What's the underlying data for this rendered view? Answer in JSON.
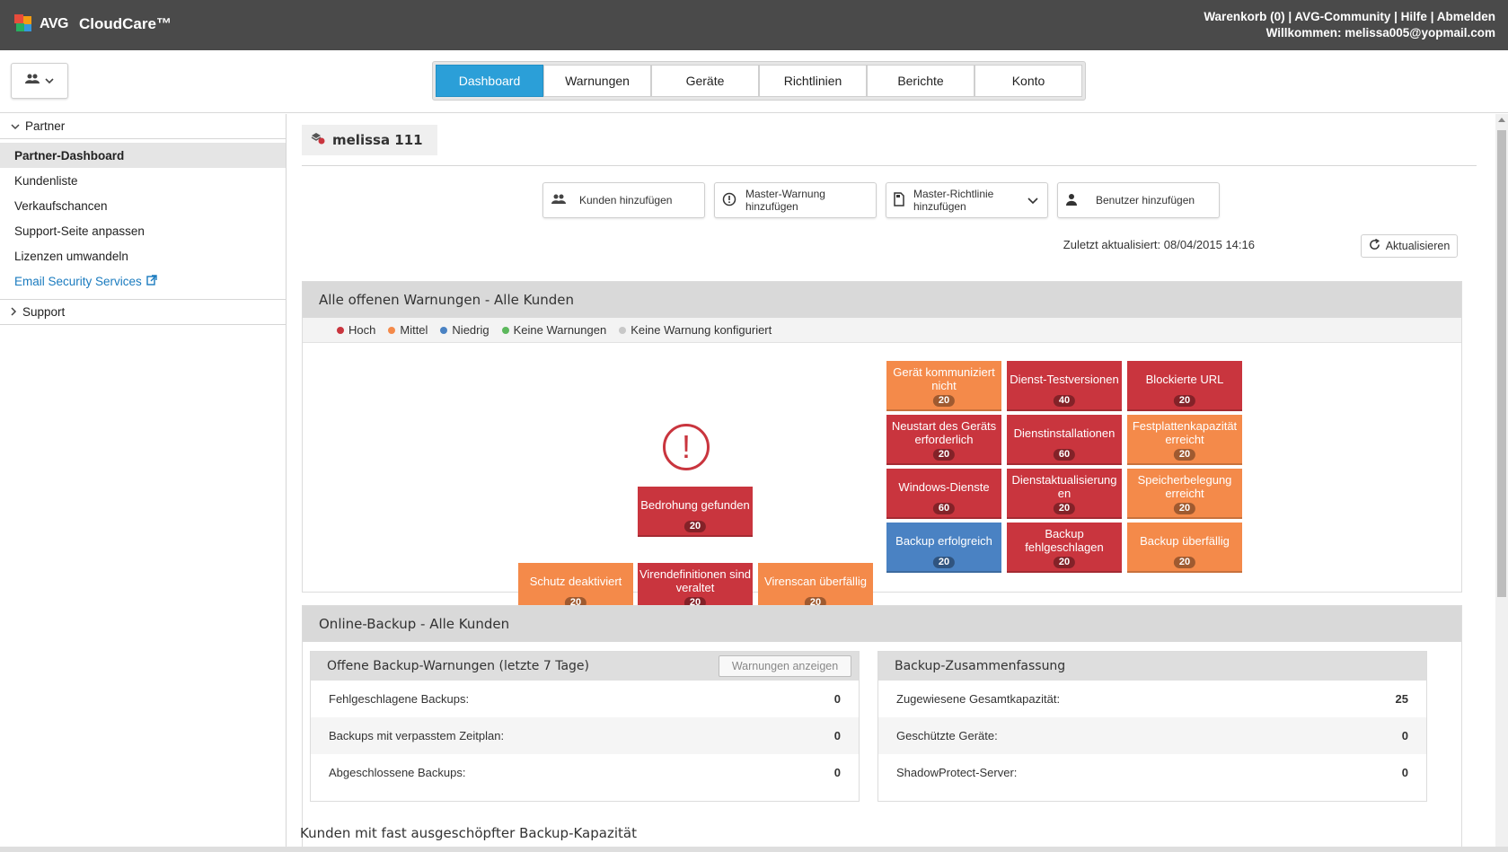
{
  "header": {
    "brand": "AVG",
    "product": "CloudCare™",
    "cart": "Warenkorb (0)",
    "community": "AVG-Community",
    "help": "Hilfe",
    "logout": "Abmelden",
    "welcome": "Willkommen: melissa005@yopmail.com"
  },
  "nav": {
    "tabs": [
      "Dashboard",
      "Warnungen",
      "Geräte",
      "Richtlinien",
      "Berichte",
      "Konto"
    ],
    "active_tab": "Dashboard"
  },
  "sidebar": {
    "partner_label": "Partner",
    "items": [
      "Partner-Dashboard",
      "Kundenliste",
      "Verkaufschancen",
      "Support-Seite anpassen",
      "Lizenzen umwandeln",
      "Email Security Services"
    ],
    "support_label": "Support"
  },
  "main": {
    "user_name": "melissa 111",
    "actions": [
      {
        "label": "Kunden hinzufügen",
        "icon": "users-icon"
      },
      {
        "label": "Master-Warnung hinzufügen",
        "icon": "alert-circle-icon"
      },
      {
        "label": "Master-Richtlinie hinzufügen",
        "icon": "document-icon"
      },
      {
        "label": "Benutzer hinzufügen",
        "icon": "user-icon"
      }
    ],
    "updated_label": "Zuletzt aktualisiert:",
    "updated_value": "08/04/2015 14:16",
    "refresh_label": "Aktualisieren"
  },
  "alerts": {
    "title": "Alle offenen Warnungen - Alle Kunden",
    "legend": [
      {
        "label": "Hoch",
        "color": "#c9353e"
      },
      {
        "label": "Mittel",
        "color": "#f48a4a"
      },
      {
        "label": "Niedrig",
        "color": "#4a82c3"
      },
      {
        "label": "Keine Warnungen",
        "color": "#5cb85c"
      },
      {
        "label": "Keine Warnung konfiguriert",
        "color": "#c8c8c8"
      }
    ],
    "tiles": {
      "threat": {
        "label": "Bedrohung gefunden",
        "count": "20",
        "severity": "high"
      },
      "protection_off": {
        "label": "Schutz deaktiviert",
        "count": "20",
        "severity": "medium"
      },
      "defs_outdated": {
        "label": "Virendefinitionen sind veraltet",
        "count": "20",
        "severity": "high"
      },
      "scan_overdue": {
        "label": "Virenscan überfällig",
        "count": "20",
        "severity": "medium"
      },
      "not_communicating": {
        "label": "Gerät kommuniziert nicht",
        "count": "20",
        "severity": "medium"
      },
      "service_trials": {
        "label": "Dienst-Testversionen",
        "count": "40",
        "severity": "high"
      },
      "blocked_url": {
        "label": "Blockierte URL",
        "count": "20",
        "severity": "high"
      },
      "restart_required": {
        "label": "Neustart des Geräts erforderlich",
        "count": "20",
        "severity": "high"
      },
      "service_installs": {
        "label": "Dienstinstallationen",
        "count": "60",
        "severity": "high"
      },
      "disk_capacity": {
        "label": "Festplattenkapazität erreicht",
        "count": "20",
        "severity": "medium"
      },
      "windows_services": {
        "label": "Windows-Dienste",
        "count": "60",
        "severity": "high"
      },
      "service_updates": {
        "label": "Dienstaktualisierung en",
        "count": "20",
        "severity": "high"
      },
      "memory_usage": {
        "label": "Speicherbelegung erreicht",
        "count": "20",
        "severity": "medium"
      },
      "backup_success": {
        "label": "Backup erfolgreich",
        "count": "20",
        "severity": "low"
      },
      "backup_failed": {
        "label": "Backup fehlgeschlagen",
        "count": "20",
        "severity": "high"
      },
      "backup_overdue": {
        "label": "Backup überfällig",
        "count": "20",
        "severity": "medium"
      }
    }
  },
  "backup": {
    "title": "Online-Backup - Alle Kunden",
    "warnings": {
      "title": "Offene Backup-Warnungen (letzte 7 Tage)",
      "button": "Warnungen anzeigen",
      "rows": [
        {
          "label": "Fehlgeschlagene Backups:",
          "value": "0"
        },
        {
          "label": "Backups mit verpasstem Zeitplan:",
          "value": "0"
        },
        {
          "label": "Abgeschlossene Backups:",
          "value": "0"
        }
      ]
    },
    "summary": {
      "title": "Backup-Zusammenfassung",
      "rows": [
        {
          "label": "Zugewiesene Gesamtkapazität:",
          "value": "25"
        },
        {
          "label": "Geschützte Geräte:",
          "value": "0"
        },
        {
          "label": "ShadowProtect-Server:",
          "value": "0"
        }
      ]
    },
    "near_full_title": "Kunden mit fast ausgeschöpfter Backup-Kapazität"
  }
}
